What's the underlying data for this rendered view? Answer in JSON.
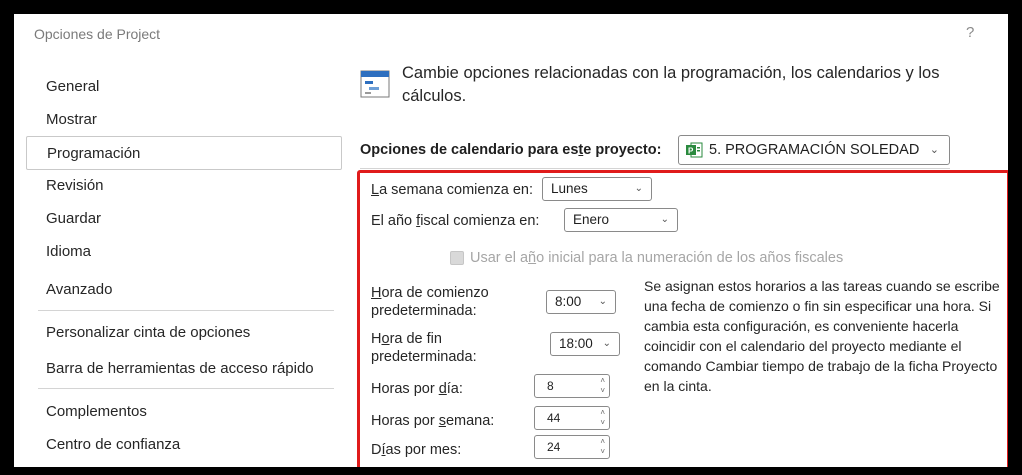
{
  "window": {
    "title": "Opciones de Project",
    "help_label": "?"
  },
  "sidebar": {
    "items": [
      {
        "label": "General"
      },
      {
        "label": "Mostrar"
      },
      {
        "label": "Programación",
        "selected": true
      },
      {
        "label": "Revisión"
      },
      {
        "label": "Guardar"
      },
      {
        "label": "Idioma"
      },
      {
        "label": "Avanzado"
      },
      {
        "label": "Personalizar cinta de opciones"
      },
      {
        "label": "Barra de herramientas de acceso rápido"
      },
      {
        "label": "Complementos"
      },
      {
        "label": "Centro de confianza"
      }
    ]
  },
  "main": {
    "header_text": "Cambie opciones relacionadas con la programación, los calendarios y los cálculos.",
    "header_icon": "calendar-icon",
    "calendar_options": {
      "label_prefix": "Opciones de calendario para es",
      "label_underlined": "t",
      "label_suffix": "e proyecto:",
      "project_value": "5. PROGRAMACIÓN SOLEDAD",
      "project_icon": "project-file-icon"
    },
    "week_start": {
      "label_u": "L",
      "label_rest": "a semana comienza en:",
      "value": "Lunes"
    },
    "fiscal_start": {
      "label_pre": "El año ",
      "label_u": "f",
      "label_rest": "iscal comienza en:",
      "value": "Enero"
    },
    "fiscal_numbering": {
      "label_pre": "Usar el a",
      "label_u": "ñ",
      "label_rest": "o inicial para la numeración de los años fiscales",
      "checked": false,
      "enabled": false
    },
    "default_start_time": {
      "label_u": "H",
      "label_line1_rest": "ora de comienzo",
      "label_line2": "predeterminada:",
      "value": "8:00"
    },
    "default_end_time": {
      "label_pre": "H",
      "label_u": "o",
      "label_line1_rest": "ra de fin",
      "label_line2": "predeterminada:",
      "value": "18:00"
    },
    "hours_per_day": {
      "label_pre": "Horas por ",
      "label_u": "d",
      "label_rest": "ía:",
      "value": "8"
    },
    "hours_per_week": {
      "label_pre": "Horas por ",
      "label_u": "s",
      "label_rest": "emana:",
      "value": "44"
    },
    "days_per_month": {
      "label_pre": "D",
      "label_u": "í",
      "label_rest": "as por mes:",
      "value": "24"
    },
    "description": "Se asignan estos horarios a las tareas cuando se escribe una fecha de comienzo o fin sin especificar una hora. Si cambia esta configuración, es conveniente hacerla coincidir con el calendario del proyecto mediante el comando Cambiar tiempo de trabajo de la ficha Proyecto en la cinta."
  },
  "colors": {
    "highlight_border": "#e01b1b",
    "project_icon_green": "#2a8a3e",
    "calendar_icon_blue": "#2e6fbf"
  }
}
